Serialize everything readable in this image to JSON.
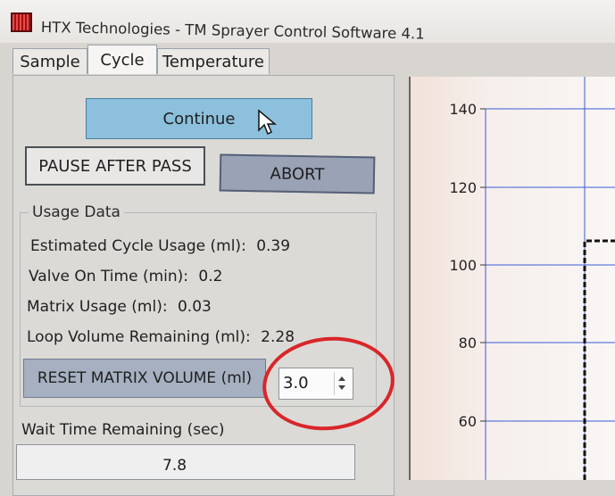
{
  "window": {
    "title": "HTX Technologies - TM Sprayer Control Software 4.1"
  },
  "tabs": [
    {
      "label": "Sample"
    },
    {
      "label": "Cycle"
    },
    {
      "label": "Temperature"
    }
  ],
  "buttons": {
    "continue": "Continue",
    "pause_after_pass": "PAUSE AFTER PASS",
    "abort": "ABORT",
    "reset_matrix_volume": "RESET MATRIX VOLUME (ml)"
  },
  "usage_data": {
    "label": "Usage Data",
    "lines": [
      {
        "label": "Estimated Cycle Usage (ml):",
        "value": "0.39"
      },
      {
        "label": "Valve On Time (min):",
        "value": "0.2"
      },
      {
        "label": "Matrix Usage (ml):",
        "value": "0.03"
      },
      {
        "label": "Loop Volume Remaining (ml):",
        "value": "2.28"
      }
    ]
  },
  "matrix_volume_stepper": {
    "value": "3.0"
  },
  "wait_time": {
    "label": "Wait Time Remaining (sec)",
    "value": "7.8"
  },
  "icons": {
    "app": "app-icon",
    "cursor": "mouse-cursor-icon",
    "stepper_up": "chevron-up-icon",
    "stepper_down": "chevron-down-icon"
  },
  "colors": {
    "continue_button": "#8cc0dc",
    "abort_button": "#9aa2b6",
    "reset_button": "#a6b0c0",
    "annotation_circle": "#d8262a",
    "gridline": "#3b5bd6"
  },
  "chart_data": {
    "type": "line",
    "yticks": [
      "140",
      "120",
      "100",
      "80",
      "60"
    ],
    "ylim": [
      60,
      140
    ],
    "grid": true
  }
}
